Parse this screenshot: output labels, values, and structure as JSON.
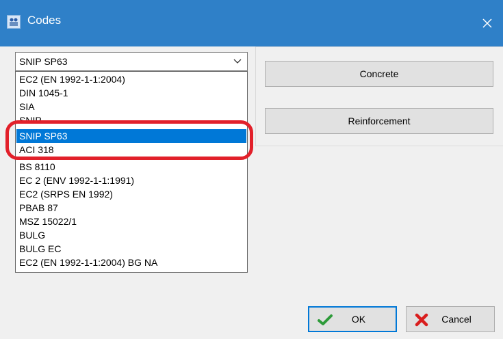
{
  "window": {
    "title": "Codes",
    "icon": "app-icon",
    "close_icon": "close-icon"
  },
  "code_combo": {
    "selected": "SNIP SP63",
    "arrow_icon": "chevron-down-icon"
  },
  "code_list": {
    "items": [
      "EC2 (EN 1992-1-1:2004)",
      "DIN 1045-1",
      "SIA",
      "SNIP",
      "SNIP SP63",
      "ACI 318",
      "BS 8110",
      "EC 2 (ENV 1992-1-1:1991)",
      "EC2 (SRPS EN 1992)",
      "PBAB 87",
      "MSZ 15022/1",
      "BULG",
      "BULG EC",
      "EC2 (EN 1992-1-1:2004) BG NA"
    ],
    "selected_index": 4
  },
  "buttons": {
    "concrete": "Concrete",
    "reinforcement": "Reinforcement",
    "ok": "OK",
    "cancel": "Cancel"
  },
  "icons": {
    "ok": "checkmark-icon",
    "cancel": "red-x-icon"
  },
  "colors": {
    "titlebar": "#2f80c8",
    "selection": "#0078d7",
    "annotation": "#e2202a"
  }
}
